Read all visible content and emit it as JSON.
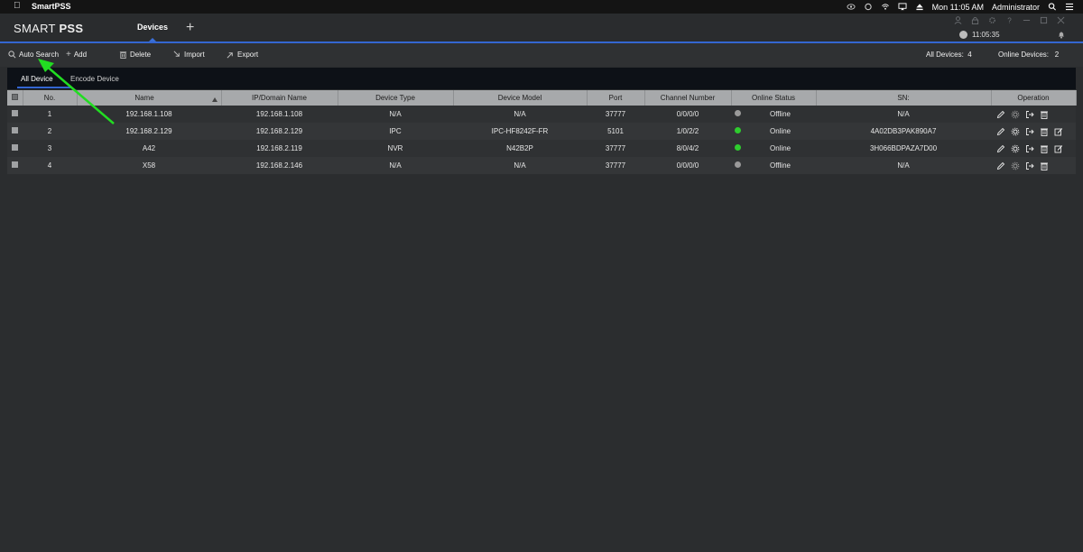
{
  "menubar": {
    "app_name": "SmartPSS",
    "datetime": "Mon 11:05 AM",
    "user": "Administrator"
  },
  "app": {
    "logo_light": "SMART",
    "logo_bold": "PSS",
    "tab_devices": "Devices",
    "tab_add": "+",
    "clock": "11:05:35"
  },
  "toolbar": {
    "auto_search": "Auto Search",
    "add": "Add",
    "delete": "Delete",
    "import": "Import",
    "export": "Export",
    "all_devices_label": "All Devices:",
    "all_devices_count": "4",
    "online_devices_label": "Online Devices:",
    "online_devices_count": "2"
  },
  "subtabs": {
    "all_device": "All Device",
    "encode_device": "Encode Device"
  },
  "table": {
    "headers": [
      "No.",
      "Name",
      "IP/Domain Name",
      "Device Type",
      "Device Model",
      "Port",
      "Channel Number",
      "Online Status",
      "SN:",
      "Operation"
    ],
    "rows": [
      {
        "no": "1",
        "name": "192.168.1.108",
        "ip": "192.168.1.108",
        "type": "N/A",
        "model": "N/A",
        "port": "37777",
        "channels": "0/0/0/0",
        "status": "Offline",
        "sn": "N/A"
      },
      {
        "no": "2",
        "name": "192.168.2.129",
        "ip": "192.168.2.129",
        "type": "IPC",
        "model": "IPC-HF8242F-FR",
        "port": "5101",
        "channels": "1/0/2/2",
        "status": "Online",
        "sn": "4A02DB3PAK890A7"
      },
      {
        "no": "3",
        "name": "A42",
        "ip": "192.168.2.119",
        "type": "NVR",
        "model": "N42B2P",
        "port": "37777",
        "channels": "8/0/4/2",
        "status": "Online",
        "sn": "3H066BDPAZA7D00"
      },
      {
        "no": "4",
        "name": "X58",
        "ip": "192.168.2.146",
        "type": "N/A",
        "model": "N/A",
        "port": "37777",
        "channels": "0/0/0/0",
        "status": "Offline",
        "sn": "N/A"
      }
    ]
  },
  "colors": {
    "accent": "#3466d1",
    "online": "#2ecc2e",
    "offline": "#9a9a9a",
    "annotation_arrow": "#22dd22"
  }
}
